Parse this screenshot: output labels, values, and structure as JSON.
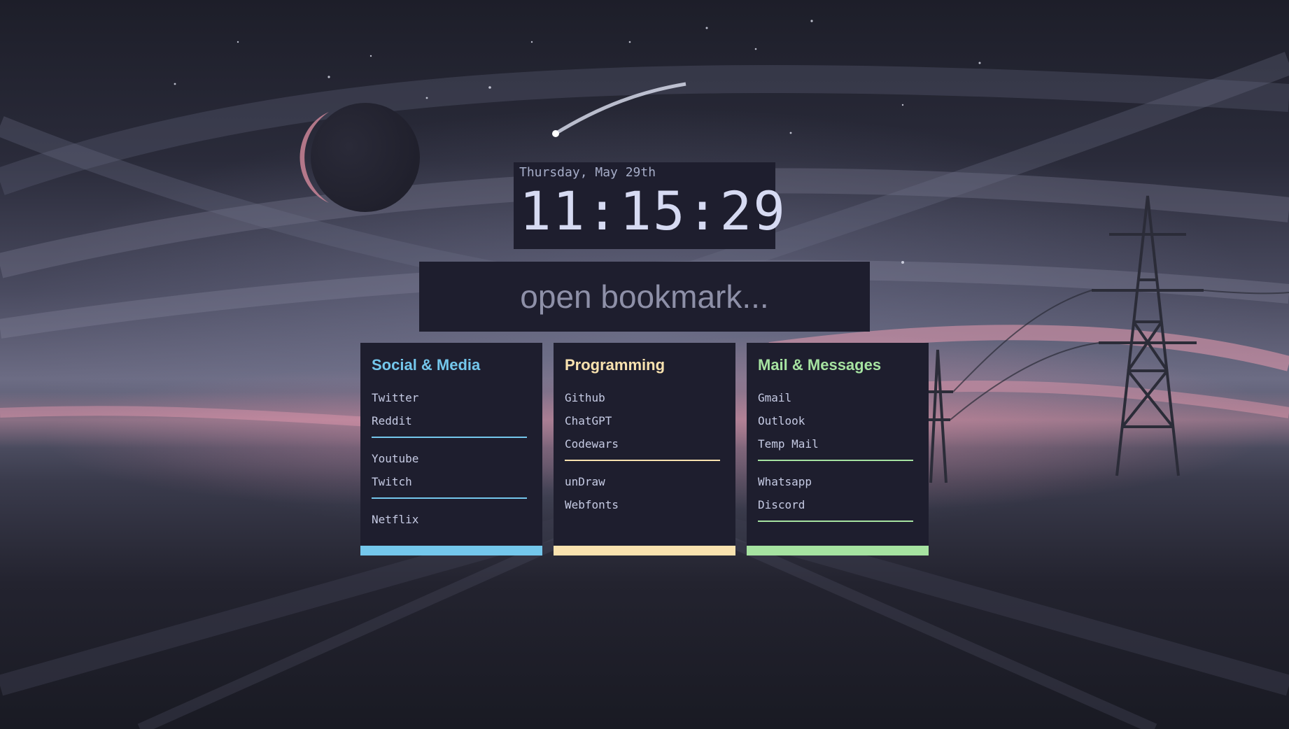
{
  "clock": {
    "date": "Thursday, May 29th",
    "time": "11:15:29"
  },
  "search": {
    "placeholder": "open bookmark..."
  },
  "colors": {
    "panel_bg": "#1e1e2e",
    "social_accent": "#74c7ec",
    "programming_accent": "#f9e2af",
    "mail_accent": "#a6e3a1",
    "link_text": "#c6cbe4"
  },
  "cards": [
    {
      "title": "Social & Media",
      "groups": [
        [
          "Twitter",
          "Reddit"
        ],
        [
          "Youtube",
          "Twitch"
        ],
        [
          "Netflix"
        ]
      ]
    },
    {
      "title": "Programming",
      "groups": [
        [
          "Github",
          "ChatGPT",
          "Codewars"
        ],
        [
          "unDraw",
          "Webfonts"
        ]
      ]
    },
    {
      "title": "Mail & Messages",
      "groups": [
        [
          "Gmail",
          "Outlook",
          "Temp Mail"
        ],
        [
          "Whatsapp",
          "Discord"
        ]
      ]
    }
  ]
}
